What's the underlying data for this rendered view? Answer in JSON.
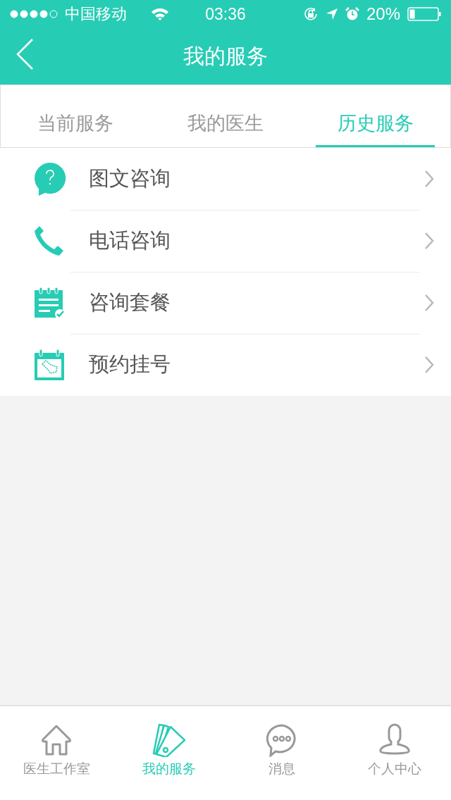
{
  "status_bar": {
    "carrier": "中国移动",
    "time": "03:36",
    "battery": "20%"
  },
  "nav": {
    "title": "我的服务"
  },
  "tabs": [
    {
      "label": "当前服务",
      "selected": false
    },
    {
      "label": "我的医生",
      "selected": false
    },
    {
      "label": "历史服务",
      "selected": true
    }
  ],
  "services": [
    {
      "kind": "chat",
      "label": "图文咨询"
    },
    {
      "kind": "phone",
      "label": "电话咨询"
    },
    {
      "kind": "notepad",
      "label": "咨询套餐"
    },
    {
      "kind": "calendar",
      "label": "预约挂号"
    }
  ],
  "tab_bar": [
    {
      "kind": "home",
      "label": "医生工作室",
      "selected": false
    },
    {
      "kind": "cards",
      "label": "我的服务",
      "selected": true
    },
    {
      "kind": "message",
      "label": "消息",
      "selected": false
    },
    {
      "kind": "person",
      "label": "个人中心",
      "selected": false
    }
  ]
}
